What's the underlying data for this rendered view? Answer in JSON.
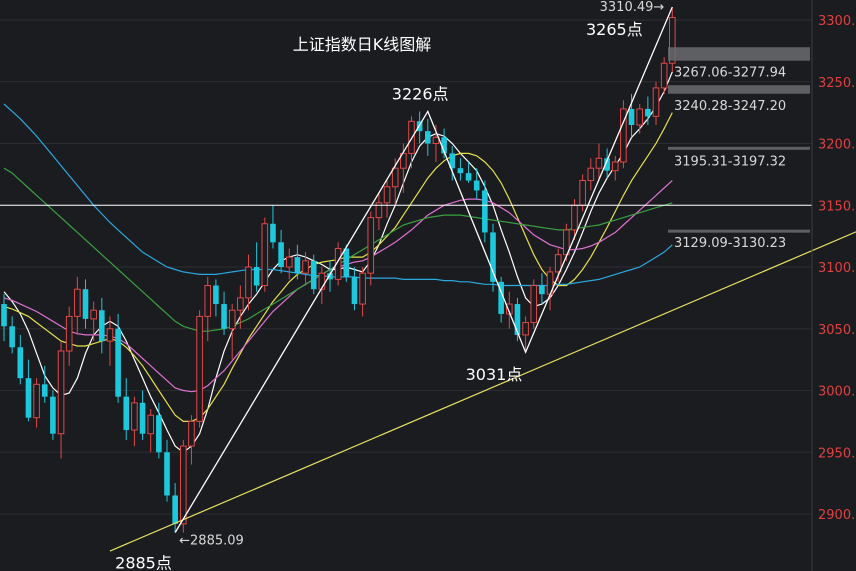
{
  "chart_data": {
    "type": "candlestick",
    "title": "上证指数日K线图解",
    "ylim": [
      2870,
      3320
    ],
    "y_ticks": [
      "3300.00",
      "3250.00",
      "3200.00",
      "3150.00",
      "3100.00",
      "3050.00",
      "3000.00",
      "2950.00",
      "2900.00"
    ],
    "y_tick_values": [
      3300,
      3250,
      3200,
      3150,
      3100,
      3050,
      3000,
      2950,
      2900
    ],
    "candles": [
      [
        3070,
        3078,
        3040,
        3052
      ],
      [
        3052,
        3060,
        3030,
        3035
      ],
      [
        3035,
        3045,
        3005,
        3010
      ],
      [
        3010,
        3025,
        2975,
        2978
      ],
      [
        2978,
        3010,
        2970,
        3005
      ],
      [
        3005,
        3020,
        2990,
        2995
      ],
      [
        2995,
        3000,
        2960,
        2965
      ],
      [
        2965,
        3040,
        2945,
        3032
      ],
      [
        3032,
        3068,
        3020,
        3060
      ],
      [
        3060,
        3092,
        3045,
        3082
      ],
      [
        3082,
        3090,
        3050,
        3058
      ],
      [
        3058,
        3072,
        3040,
        3065
      ],
      [
        3065,
        3075,
        3030,
        3040
      ],
      [
        3040,
        3060,
        3020,
        3050
      ],
      [
        3050,
        3062,
        2990,
        2995
      ],
      [
        2995,
        3010,
        2960,
        2968
      ],
      [
        2968,
        2995,
        2955,
        2990
      ],
      [
        2990,
        3000,
        2960,
        2965
      ],
      [
        2965,
        2985,
        2950,
        2980
      ],
      [
        2980,
        2990,
        2945,
        2950
      ],
      [
        2950,
        2960,
        2910,
        2915
      ],
      [
        2915,
        2925,
        2885,
        2892
      ],
      [
        2892,
        2960,
        2885,
        2955
      ],
      [
        2955,
        2980,
        2940,
        2975
      ],
      [
        2975,
        3065,
        2970,
        3060
      ],
      [
        3060,
        3092,
        3040,
        3085
      ],
      [
        3085,
        3090,
        3060,
        3070
      ],
      [
        3070,
        3080,
        3045,
        3050
      ],
      [
        3050,
        3070,
        3025,
        3065
      ],
      [
        3065,
        3085,
        3050,
        3075
      ],
      [
        3075,
        3110,
        3065,
        3100
      ],
      [
        3100,
        3120,
        3080,
        3085
      ],
      [
        3085,
        3140,
        3080,
        3135
      ],
      [
        3135,
        3150,
        3115,
        3120
      ],
      [
        3120,
        3130,
        3095,
        3100
      ],
      [
        3100,
        3115,
        3090,
        3108
      ],
      [
        3108,
        3118,
        3090,
        3095
      ],
      [
        3095,
        3112,
        3085,
        3105
      ],
      [
        3105,
        3110,
        3078,
        3082
      ],
      [
        3082,
        3100,
        3070,
        3095
      ],
      [
        3095,
        3105,
        3080,
        3090
      ],
      [
        3090,
        3120,
        3085,
        3115
      ],
      [
        3115,
        3118,
        3088,
        3092
      ],
      [
        3092,
        3100,
        3065,
        3070
      ],
      [
        3070,
        3100,
        3060,
        3095
      ],
      [
        3095,
        3145,
        3085,
        3140
      ],
      [
        3140,
        3160,
        3130,
        3152
      ],
      [
        3152,
        3170,
        3140,
        3165
      ],
      [
        3165,
        3188,
        3150,
        3180
      ],
      [
        3180,
        3200,
        3160,
        3192
      ],
      [
        3192,
        3222,
        3180,
        3218
      ],
      [
        3218,
        3226,
        3200,
        3210
      ],
      [
        3210,
        3220,
        3190,
        3200
      ],
      [
        3200,
        3215,
        3185,
        3205
      ],
      [
        3205,
        3212,
        3188,
        3192
      ],
      [
        3192,
        3198,
        3170,
        3180
      ],
      [
        3180,
        3188,
        3170,
        3176
      ],
      [
        3176,
        3185,
        3168,
        3170
      ],
      [
        3170,
        3180,
        3155,
        3162
      ],
      [
        3162,
        3170,
        3120,
        3128
      ],
      [
        3128,
        3135,
        3080,
        3088
      ],
      [
        3088,
        3092,
        3055,
        3062
      ],
      [
        3062,
        3080,
        3050,
        3070
      ],
      [
        3070,
        3075,
        3040,
        3045
      ],
      [
        3045,
        3060,
        3031,
        3055
      ],
      [
        3055,
        3090,
        3050,
        3085
      ],
      [
        3085,
        3095,
        3070,
        3078
      ],
      [
        3078,
        3100,
        3065,
        3096
      ],
      [
        3096,
        3115,
        3088,
        3110
      ],
      [
        3110,
        3135,
        3105,
        3130
      ],
      [
        3130,
        3155,
        3122,
        3150
      ],
      [
        3150,
        3175,
        3145,
        3170
      ],
      [
        3170,
        3188,
        3162,
        3180
      ],
      [
        3180,
        3200,
        3170,
        3188
      ],
      [
        3188,
        3196,
        3172,
        3178
      ],
      [
        3178,
        3190,
        3170,
        3185
      ],
      [
        3185,
        3235,
        3180,
        3228
      ],
      [
        3228,
        3240,
        3205,
        3215
      ],
      [
        3215,
        3232,
        3208,
        3228
      ],
      [
        3228,
        3238,
        3215,
        3222
      ],
      [
        3222,
        3250,
        3215,
        3245
      ],
      [
        3245,
        3270,
        3240,
        3265
      ],
      [
        3265,
        3310.49,
        3258,
        3302
      ]
    ],
    "ma_lines": [
      {
        "color": "#ffffff",
        "values": [
          3080,
          3072,
          3062,
          3048,
          3030,
          3012,
          3002,
          2996,
          2998,
          3010,
          3030,
          3045,
          3052,
          3056,
          3052,
          3040,
          3025,
          3010,
          2995,
          2982,
          2968,
          2955,
          2950,
          2955,
          2965,
          2985,
          3010,
          3032,
          3048,
          3060,
          3070,
          3078,
          3088,
          3098,
          3105,
          3108,
          3110,
          3108,
          3105,
          3102,
          3098,
          3098,
          3100,
          3098,
          3096,
          3105,
          3118,
          3135,
          3150,
          3168,
          3185,
          3198,
          3205,
          3208,
          3206,
          3200,
          3192,
          3185,
          3178,
          3165,
          3150,
          3130,
          3112,
          3092,
          3075,
          3068,
          3070,
          3075,
          3085,
          3098,
          3112,
          3128,
          3145,
          3160,
          3172,
          3182,
          3192,
          3205,
          3212,
          3220,
          3230,
          3242,
          3258
        ]
      },
      {
        "color": "#e6e04a",
        "values": [
          3068,
          3066,
          3063,
          3060,
          3055,
          3050,
          3045,
          3040,
          3038,
          3036,
          3036,
          3038,
          3040,
          3042,
          3040,
          3035,
          3028,
          3020,
          3010,
          3000,
          2990,
          2980,
          2975,
          2975,
          2978,
          2985,
          2995,
          3005,
          3018,
          3030,
          3042,
          3052,
          3062,
          3072,
          3080,
          3088,
          3094,
          3098,
          3102,
          3104,
          3105,
          3106,
          3108,
          3108,
          3108,
          3112,
          3118,
          3125,
          3132,
          3142,
          3152,
          3162,
          3172,
          3180,
          3186,
          3190,
          3192,
          3192,
          3190,
          3185,
          3178,
          3168,
          3155,
          3140,
          3125,
          3110,
          3098,
          3090,
          3085,
          3085,
          3090,
          3098,
          3108,
          3120,
          3132,
          3145,
          3158,
          3170,
          3180,
          3190,
          3200,
          3212,
          3225
        ]
      },
      {
        "color": "#e070d0",
        "values": [
          3075,
          3073,
          3070,
          3067,
          3064,
          3060,
          3056,
          3052,
          3048,
          3046,
          3045,
          3045,
          3045,
          3044,
          3042,
          3038,
          3032,
          3026,
          3020,
          3014,
          3008,
          3002,
          3000,
          2999,
          3000,
          3004,
          3010,
          3016,
          3024,
          3032,
          3040,
          3048,
          3056,
          3064,
          3070,
          3076,
          3082,
          3086,
          3090,
          3094,
          3098,
          3100,
          3102,
          3104,
          3105,
          3108,
          3112,
          3116,
          3120,
          3125,
          3130,
          3136,
          3142,
          3146,
          3150,
          3152,
          3154,
          3155,
          3155,
          3154,
          3152,
          3148,
          3144,
          3138,
          3132,
          3126,
          3122,
          3118,
          3116,
          3114,
          3114,
          3115,
          3117,
          3120,
          3124,
          3128,
          3134,
          3140,
          3146,
          3152,
          3158,
          3164,
          3170
        ]
      },
      {
        "color": "#3aa040",
        "values": [
          3180,
          3176,
          3170,
          3164,
          3158,
          3152,
          3146,
          3140,
          3134,
          3128,
          3122,
          3116,
          3110,
          3104,
          3098,
          3092,
          3086,
          3080,
          3074,
          3068,
          3062,
          3056,
          3052,
          3050,
          3048,
          3048,
          3049,
          3050,
          3052,
          3055,
          3058,
          3062,
          3066,
          3070,
          3074,
          3078,
          3082,
          3086,
          3090,
          3094,
          3098,
          3102,
          3106,
          3110,
          3114,
          3118,
          3122,
          3126,
          3130,
          3134,
          3136,
          3138,
          3140,
          3141,
          3142,
          3142,
          3142,
          3141,
          3140,
          3139,
          3138,
          3137,
          3136,
          3135,
          3134,
          3133,
          3132,
          3131,
          3130,
          3130,
          3131,
          3132,
          3133,
          3134,
          3136,
          3138,
          3140,
          3142,
          3144,
          3146,
          3148,
          3150,
          3152
        ]
      },
      {
        "color": "#2aa8e0",
        "values": [
          3232,
          3226,
          3220,
          3213,
          3206,
          3198,
          3190,
          3182,
          3174,
          3166,
          3158,
          3150,
          3143,
          3136,
          3130,
          3124,
          3118,
          3112,
          3108,
          3104,
          3100,
          3098,
          3096,
          3095,
          3094,
          3094,
          3094,
          3095,
          3096,
          3097,
          3098,
          3098,
          3098,
          3098,
          3097,
          3096,
          3095,
          3094,
          3093,
          3093,
          3092,
          3092,
          3092,
          3092,
          3091,
          3091,
          3091,
          3091,
          3091,
          3090,
          3090,
          3090,
          3090,
          3090,
          3089,
          3089,
          3088,
          3088,
          3087,
          3086,
          3086,
          3085,
          3085,
          3085,
          3085,
          3085,
          3085,
          3085,
          3086,
          3086,
          3087,
          3088,
          3089,
          3090,
          3092,
          3094,
          3096,
          3098,
          3100,
          3104,
          3108,
          3112,
          3118
        ]
      }
    ],
    "annotations": {
      "high_label": "3310.49",
      "low_label": "2885.09",
      "points": [
        {
          "text": "3226点",
          "x_index": 52,
          "y": 3226
        },
        {
          "text": "3031点",
          "x_index": 64,
          "y": 3031
        },
        {
          "text": "3265点",
          "x_index": 80,
          "y": 3265
        },
        {
          "text": "2885点",
          "x_index": 21,
          "y": 2885
        }
      ],
      "zigzag": [
        [
          21,
          2885
        ],
        [
          52,
          3226
        ],
        [
          64,
          3031
        ],
        [
          82,
          3310.49
        ]
      ],
      "gaps": [
        {
          "label": "3267.06-3277.94",
          "low": 3267.06,
          "high": 3277.94
        },
        {
          "label": "3240.28-3247.20",
          "low": 3240.28,
          "high": 3247.2
        },
        {
          "label": "3195.31-3197.32",
          "low": 3195.31,
          "high": 3197.32
        },
        {
          "label": "3129.09-3130.23",
          "low": 3129.09,
          "high": 3130.23
        }
      ],
      "horizontal_line": 3150,
      "trendline": [
        [
          13,
          2870
        ],
        [
          115,
          3158
        ]
      ]
    }
  }
}
